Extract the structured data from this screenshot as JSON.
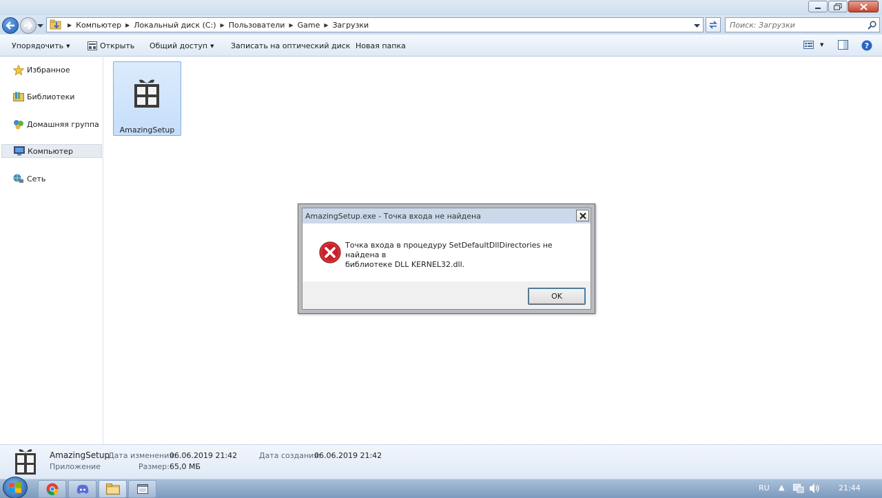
{
  "window": {
    "buttons": [
      "minimize",
      "maximize",
      "close"
    ]
  },
  "address": {
    "crumbs": [
      "Компьютер",
      "Локальный диск (C:)",
      "Пользователи",
      "Game",
      "Загрузки"
    ],
    "search_placeholder": "Поиск: Загрузки"
  },
  "commands": {
    "organize": "Упорядочить",
    "open": "Открыть",
    "share": "Общий доступ",
    "burn": "Записать на оптический диск",
    "new_folder": "Новая папка"
  },
  "nav": {
    "favorites": "Избранное",
    "libraries": "Библиотеки",
    "homegroup": "Домашняя группа",
    "computer": "Компьютер",
    "network": "Сеть"
  },
  "files": [
    {
      "name": "AmazingSetup"
    }
  ],
  "details": {
    "name": "AmazingSetup",
    "type": "Приложение",
    "modified_label": "Дата изменения:",
    "modified_value": "06.06.2019 21:42",
    "created_label": "Дата создания:",
    "created_value": "06.06.2019 21:42",
    "size_label": "Размер:",
    "size_value": "65,0 МБ"
  },
  "dialog": {
    "title": "AmazingSetup.exe - Точка входа не найдена",
    "message_line1": "Точка входа в процедуру SetDefaultDllDirectories не найдена в",
    "message_line2": "библиотеке DLL KERNEL32.dll.",
    "ok_label": "OK"
  },
  "taskbar": {
    "lang": "RU",
    "time": "21:44",
    "apps": [
      "chrome-icon",
      "discord-icon",
      "explorer-icon",
      "window-icon"
    ]
  },
  "colors": {
    "selection": "#c5defb",
    "error_red": "#c8202a",
    "taskbar": "#7c9abd"
  }
}
